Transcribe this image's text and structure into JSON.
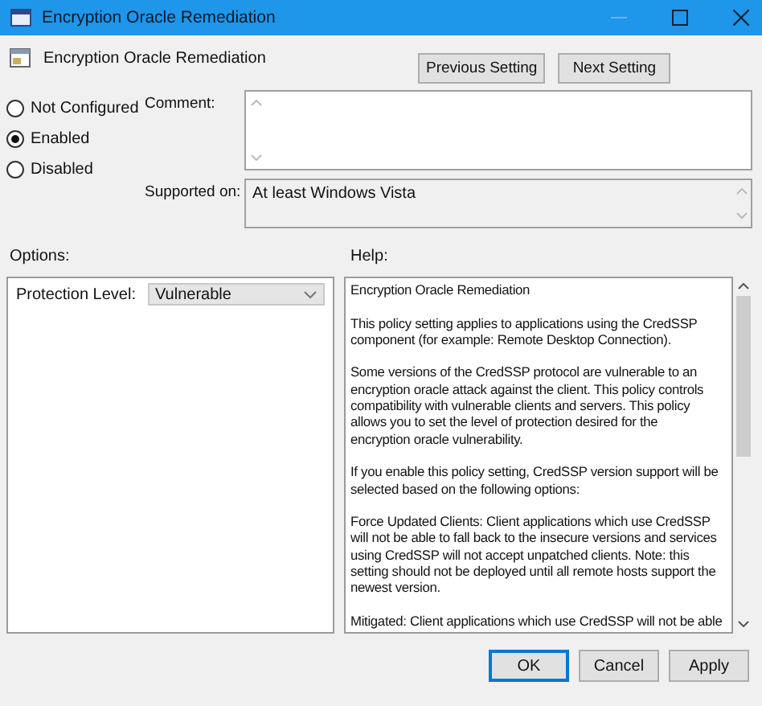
{
  "window": {
    "title": "Encryption Oracle Remediation"
  },
  "header": {
    "title": "Encryption Oracle Remediation",
    "buttons": [
      "Previous Setting",
      "Next Setting"
    ]
  },
  "state_options": [
    {
      "label": "Not Configured",
      "selected": false
    },
    {
      "label": "Enabled",
      "selected": true
    },
    {
      "label": "Disabled",
      "selected": false
    }
  ],
  "comment": {
    "label": "Comment:"
  },
  "supported_on": {
    "label": "Supported on:",
    "value": "At least Windows Vista"
  },
  "options": {
    "label": "Options:",
    "protection_level": {
      "label": "Protection Level:",
      "value": "Vulnerable"
    }
  },
  "help": {
    "label": "Help:",
    "paragraphs": [
      [
        "Encryption Oracle Remediation"
      ],
      [
        "This policy setting applies to applications using the CredSSP",
        "component (for example: Remote Desktop Connection)."
      ],
      [
        "Some versions of the CredSSP protocol are vulnerable to an",
        "encryption oracle attack against the client.  This policy controls",
        "compatibility with vulnerable clients and servers.  This policy",
        "allows you to set the level of protection desired for the",
        "encryption oracle vulnerability."
      ],
      [
        "If you enable this policy setting, CredSSP version support will be",
        "selected based on the following options:"
      ],
      [
        "Force Updated Clients: Client applications which use CredSSP",
        "will not be able to fall back to the insecure versions and services",
        "using CredSSP will not accept unpatched clients. Note: this",
        "setting should not be deployed until all remote hosts support the",
        "newest version."
      ],
      [
        "Mitigated: Client applications which use CredSSP will not be able"
      ]
    ]
  },
  "footer_buttons": [
    {
      "label": "OK",
      "kind": "default"
    },
    {
      "label": "Cancel",
      "kind": "normal"
    },
    {
      "label": "Apply",
      "kind": "normal"
    }
  ]
}
